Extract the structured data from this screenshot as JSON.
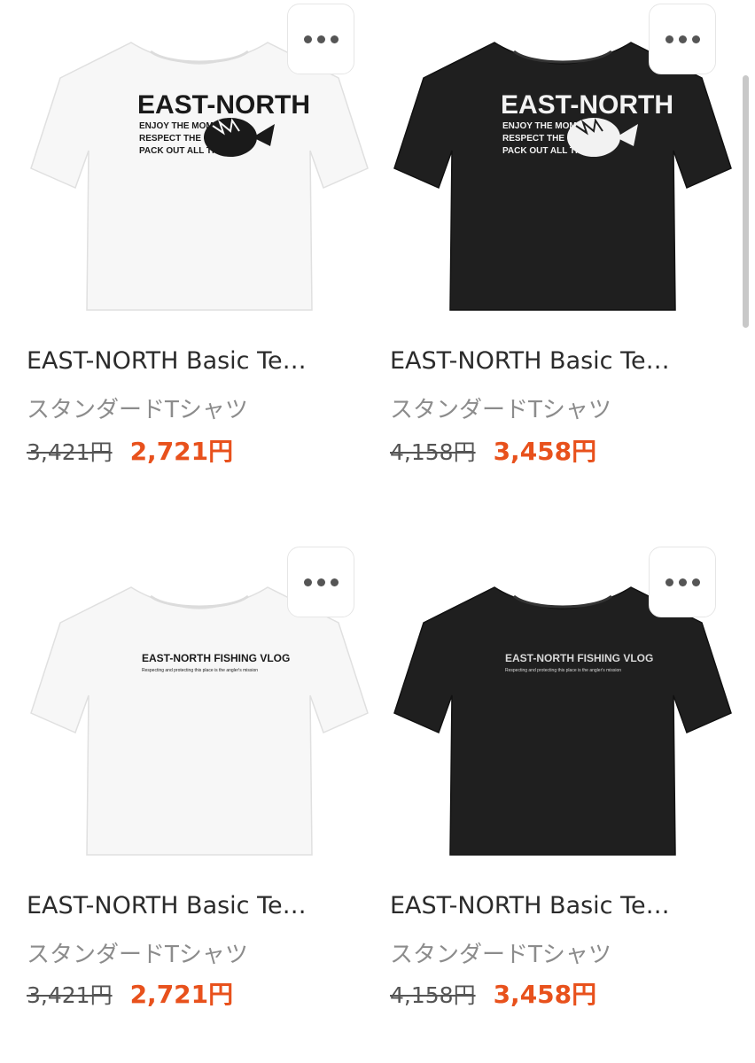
{
  "products": [
    {
      "title": "EAST-NORTH Basic Te…",
      "subtitle": "スタンダードTシャツ",
      "old_price": "3,421円",
      "new_price": "2,721円",
      "shirt_color": "#f7f7f7",
      "print_color": "#1a1a1a",
      "design": "logo-fish",
      "print": {
        "headline": "EAST-NORTH",
        "line1": "ENJOY THE MOMENT",
        "line2": "RESPECT THE OCEAN",
        "line3": "PACK OUT ALL TRASH"
      }
    },
    {
      "title": "EAST-NORTH Basic Te…",
      "subtitle": "スタンダードTシャツ",
      "old_price": "4,158円",
      "new_price": "3,458円",
      "shirt_color": "#1f1f1f",
      "print_color": "#f2f2f2",
      "design": "logo-fish",
      "print": {
        "headline": "EAST-NORTH",
        "line1": "ENJOY THE MOMENT",
        "line2": "RESPECT THE OCEAN",
        "line3": "PACK OUT ALL TRASH"
      }
    },
    {
      "title": "EAST-NORTH Basic Te…",
      "subtitle": "スタンダードTシャツ",
      "old_price": "3,421円",
      "new_price": "2,721円",
      "shirt_color": "#f7f7f7",
      "print_color": "#1a1a1a",
      "design": "wordmark",
      "print": {
        "headline": "EAST-NORTH FISHING VLOG",
        "line1": "Respecting and protecting this place is the angler's mission"
      }
    },
    {
      "title": "EAST-NORTH Basic Te…",
      "subtitle": "スタンダードTシャツ",
      "old_price": "4,158円",
      "new_price": "3,458円",
      "shirt_color": "#1f1f1f",
      "print_color": "#d8d8d8",
      "design": "wordmark",
      "print": {
        "headline": "EAST-NORTH FISHING VLOG",
        "line1": "Respecting and protecting this place is the angler's mission"
      }
    }
  ],
  "icons": {
    "more": "more-horizontal-icon"
  }
}
